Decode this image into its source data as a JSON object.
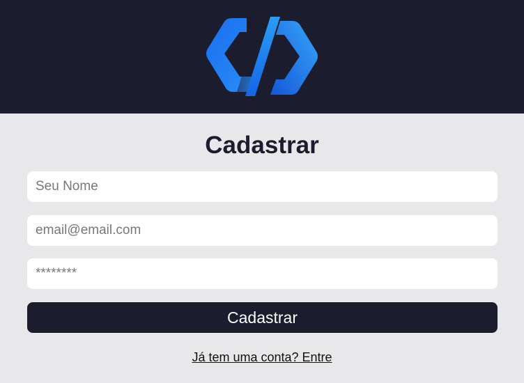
{
  "header": {
    "logo_icon": "code-brackets-logo-icon",
    "brand_colors": [
      "#1565e8",
      "#2a9df4",
      "#1b1d2e"
    ]
  },
  "form": {
    "title": "Cadastrar",
    "name_placeholder": "Seu Nome",
    "email_placeholder": "email@email.com",
    "password_placeholder": "********",
    "submit_label": "Cadastrar",
    "login_link": "Já tem uma conta? Entre"
  },
  "colors": {
    "header_bg": "#1b1d2e",
    "page_bg": "#e8e8ea",
    "button_bg": "#1b1d2e"
  }
}
